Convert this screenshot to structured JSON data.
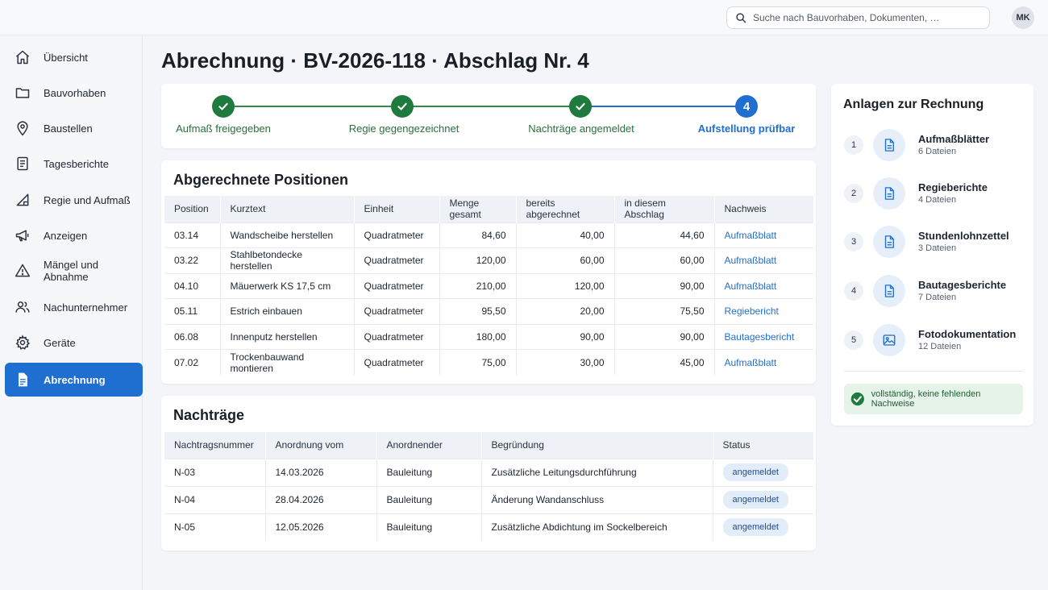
{
  "header": {
    "search_placeholder": "Suche nach Bauvorhaben, Dokumenten, …",
    "avatar_initials": "MK"
  },
  "sidebar": {
    "items": [
      {
        "label": "Übersicht",
        "icon": "home-icon"
      },
      {
        "label": "Bauvorhaben",
        "icon": "folder-icon"
      },
      {
        "label": "Baustellen",
        "icon": "location-pin-icon"
      },
      {
        "label": "Tagesberichte",
        "icon": "document-list-icon"
      },
      {
        "label": "Regie und Aufmaß",
        "icon": "measure-triangle-icon"
      },
      {
        "label": "Anzeigen",
        "icon": "megaphone-icon"
      },
      {
        "label": "Mängel und Abnahme",
        "icon": "warning-icon"
      },
      {
        "label": "Nachunternehmer",
        "icon": "users-icon"
      },
      {
        "label": "Geräte",
        "icon": "gear-icon"
      },
      {
        "label": "Abrechnung",
        "icon": "invoice-icon",
        "active": true
      }
    ]
  },
  "page": {
    "title": "Abrechnung · BV-2026-118 · Abschlag Nr. 4"
  },
  "stepper": {
    "steps": [
      {
        "label": "Aufmaß freigegeben",
        "state": "done"
      },
      {
        "label": "Regie gegengezeichnet",
        "state": "done"
      },
      {
        "label": "Nachträge angemeldet",
        "state": "done"
      },
      {
        "label": "Aufstellung prüfbar",
        "state": "current",
        "number": "4"
      }
    ]
  },
  "positions": {
    "title": "Abgerechnete Positionen",
    "columns": [
      "Position",
      "Kurztext",
      "Einheit",
      "Menge gesamt",
      "bereits abgerechnet",
      "in diesem Abschlag",
      "Nachweis"
    ],
    "rows": [
      [
        "03.14",
        "Wandscheibe herstellen",
        "Quadratmeter",
        "84,60",
        "40,00",
        "44,60",
        "Aufmaßblatt"
      ],
      [
        "03.22",
        "Stahlbetondecke herstellen",
        "Quadratmeter",
        "120,00",
        "60,00",
        "60,00",
        "Aufmaßblatt"
      ],
      [
        "04.10",
        "Mäuerwerk KS 17,5 cm",
        "Quadratmeter",
        "210,00",
        "120,00",
        "90,00",
        "Aufmaßblatt"
      ],
      [
        "05.11",
        "Estrich einbauen",
        "Quadratmeter",
        "95,50",
        "20,00",
        "75,50",
        "Regiebericht"
      ],
      [
        "06.08",
        "Innenputz herstellen",
        "Quadratmeter",
        "180,00",
        "90,00",
        "90,00",
        "Bautagesbericht"
      ],
      [
        "07.02",
        "Trockenbauwand montieren",
        "Quadratmeter",
        "75,00",
        "30,00",
        "45,00",
        "Aufmaßblatt"
      ]
    ]
  },
  "nachtraege": {
    "title": "Nachträge",
    "columns": [
      "Nachtragsnummer",
      "Anordnung vom",
      "Anordnender",
      "Begründung",
      "Status"
    ],
    "rows": [
      [
        "N-03",
        "14.03.2026",
        "Bauleitung",
        "Zusätzliche Leitungsdurchführung",
        "angemeldet"
      ],
      [
        "N-04",
        "28.04.2026",
        "Bauleitung",
        "Änderung Wandanschluss",
        "angemeldet"
      ],
      [
        "N-05",
        "12.05.2026",
        "Bauleitung",
        "Zusätzliche Abdichtung im Sockelbereich",
        "angemeldet"
      ]
    ]
  },
  "attachments": {
    "title": "Anlagen zur Rechnung",
    "items": [
      {
        "num": "1",
        "name": "Aufmaßblätter",
        "count": "6 Dateien",
        "icon": "document-icon"
      },
      {
        "num": "2",
        "name": "Regieberichte",
        "count": "4 Dateien",
        "icon": "document-icon"
      },
      {
        "num": "3",
        "name": "Stundenlohnzettel",
        "count": "3 Dateien",
        "icon": "document-icon"
      },
      {
        "num": "4",
        "name": "Bautagesberichte",
        "count": "7 Dateien",
        "icon": "document-icon"
      },
      {
        "num": "5",
        "name": "Fotodokumentation",
        "count": "12 Dateien",
        "icon": "image-icon"
      }
    ],
    "status": "vollständig, keine fehlenden Nachweise"
  },
  "colors": {
    "primary": "#1f6fd1",
    "success": "#1f7a3e",
    "success_bg": "#e5f3e9",
    "badge_bg": "#e3edf9"
  }
}
